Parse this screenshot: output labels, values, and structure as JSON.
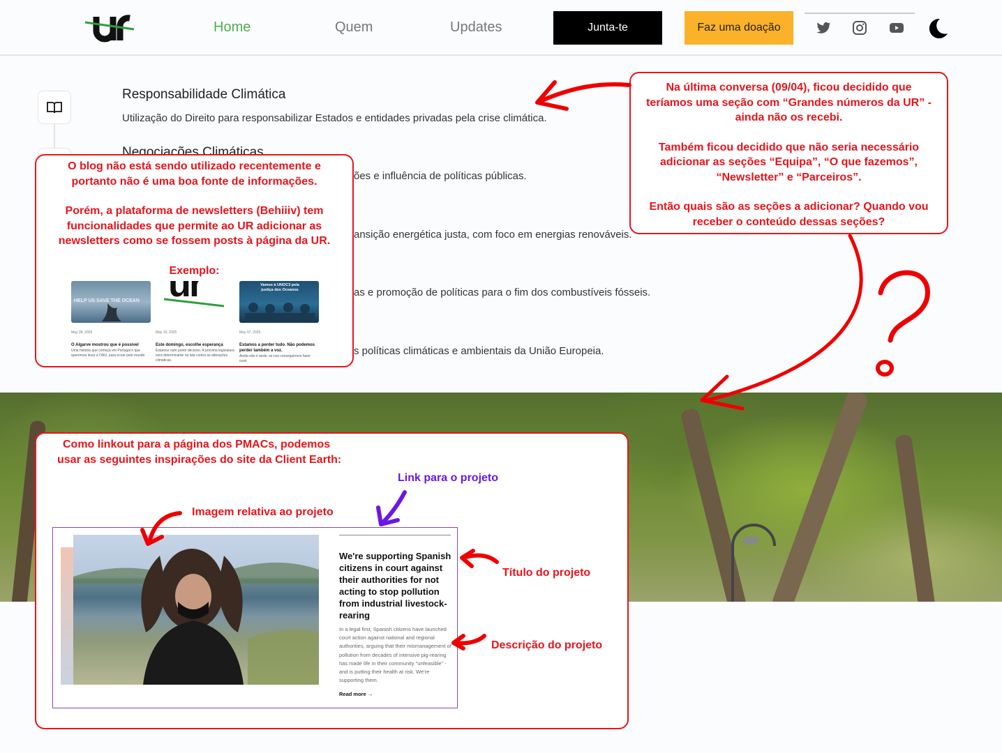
{
  "header": {
    "logo_text": "ur",
    "nav": [
      "Home",
      "Quem",
      "Updates"
    ],
    "join_label": "Junta-te",
    "donate_label": "Faz uma doação",
    "social_icons": [
      "twitter-icon",
      "instagram-icon",
      "youtube-icon"
    ],
    "theme_icon": "moon-icon"
  },
  "colors": {
    "brand_green": "#4caf50",
    "donate": "#fbb12a",
    "annotation_red": "#e8141c",
    "annotation_purple": "#6a17e6"
  },
  "items": [
    {
      "title": "Responsabilidade Climática",
      "desc": "Utilização do Direito para responsabilizar Estados e entidades privadas pela crise climática."
    },
    {
      "title": "Negociações Climáticas",
      "desc": "ões e influência de políticas públicas."
    },
    {
      "desc": "ansição energética justa, com foco em energias renováveis."
    },
    {
      "desc": "as e promoção de políticas para o fim dos combustíveis fósseis."
    },
    {
      "desc": "s políticas climáticas e ambientais da União Europeia."
    }
  ],
  "notes": {
    "blog": [
      "O blog não está sendo utilizado recentemente e",
      "portanto não é uma boa fonte de informações.",
      "",
      "Porém, a plataforma de newsletters (Behiiiv) tem",
      "funcionalidades que permite ao UR adicionar as",
      "newsletters como se fossem posts à página da UR.",
      "",
      "Exemplo:"
    ],
    "sections": [
      "Na última conversa (09/04), ficou decidido que",
      "teríamos uma seção com “Grandes números da UR” -",
      "ainda não os recebi.",
      "",
      "Também ficou decidido que não seria necessário",
      "adicionar as seções “Equipa”, “O que fazemos”,",
      "“Newsletter” e “Parceiros”.",
      "",
      "Então quais são as seções a adicionar? Quando vou",
      "receber o conteúdo dessas seções?"
    ],
    "pmac": [
      "Como linkout para a página dos PMACs, podemos",
      "usar as seguintes inspirações do site da Client Earth:"
    ],
    "question_mark": "?"
  },
  "thumbs": [
    {
      "overlay": "HELP US SAVE THE OCEAN",
      "date": "May 28, 2025",
      "title": "O Algarve mostrou que é possível",
      "text": "Uma história que começa em Portugal e que queremos levar à ONU, para ecoar pelo mundo"
    },
    {
      "overlay": "ur",
      "date": "May 15, 2025",
      "title": "Este domingo, escolhe esperança",
      "text": "Estamos num ponto decisivo. A próxima legislatura será determinante na luta contra as alterações climáticas."
    },
    {
      "overlay": "Vamos à UNOC3 pela justiça dos Oceanos",
      "date": "May 07, 2025",
      "title": "Estamos a perder tudo. Não podemos perder também a voz.",
      "text": "Ainda não é tarde, se nos conseguirmos fazer ouvir"
    }
  ],
  "labels": {
    "link": "Link para o projeto",
    "image": "Imagem relativa ao projeto",
    "title": "Título do projeto",
    "desc": "Descrição do projeto"
  },
  "card": {
    "title": "We're supporting Spanish citizens in court against their authorities for not acting to stop pollution from industrial livestock-rearing",
    "desc": "In a legal first, Spanish citizens have launched court action against national and regional authorities, arguing that their mismanagement of pollution from decades of intensive pig-rearing has made life in their community \"unfeasible\" - and is putting their health at risk. We're supporting them.",
    "more": "Read more →"
  }
}
